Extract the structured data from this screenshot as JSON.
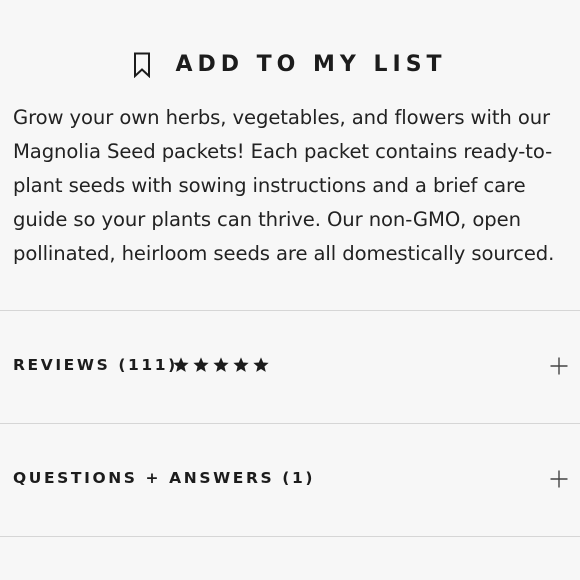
{
  "add_to_list": {
    "label": "ADD TO MY LIST",
    "icon": "bookmark-icon"
  },
  "description": "Grow your own herbs, vegetables, and flowers with our Magnolia Seed packets! Each packet contains ready-to-plant seeds with sowing instructions and a brief care guide so your plants can thrive. Our non-GMO, open pollinated, heirloom seeds are all domestically sourced.",
  "accordions": {
    "reviews": {
      "label": "REVIEWS (111)",
      "rating": 5,
      "expand_icon": "plus-icon"
    },
    "questions": {
      "label": "QUESTIONS + ANSWERS (1)",
      "expand_icon": "plus-icon"
    }
  },
  "colors": {
    "text": "#1c1c1c",
    "background": "#f7f7f7",
    "divider": "#d6d6d6"
  }
}
